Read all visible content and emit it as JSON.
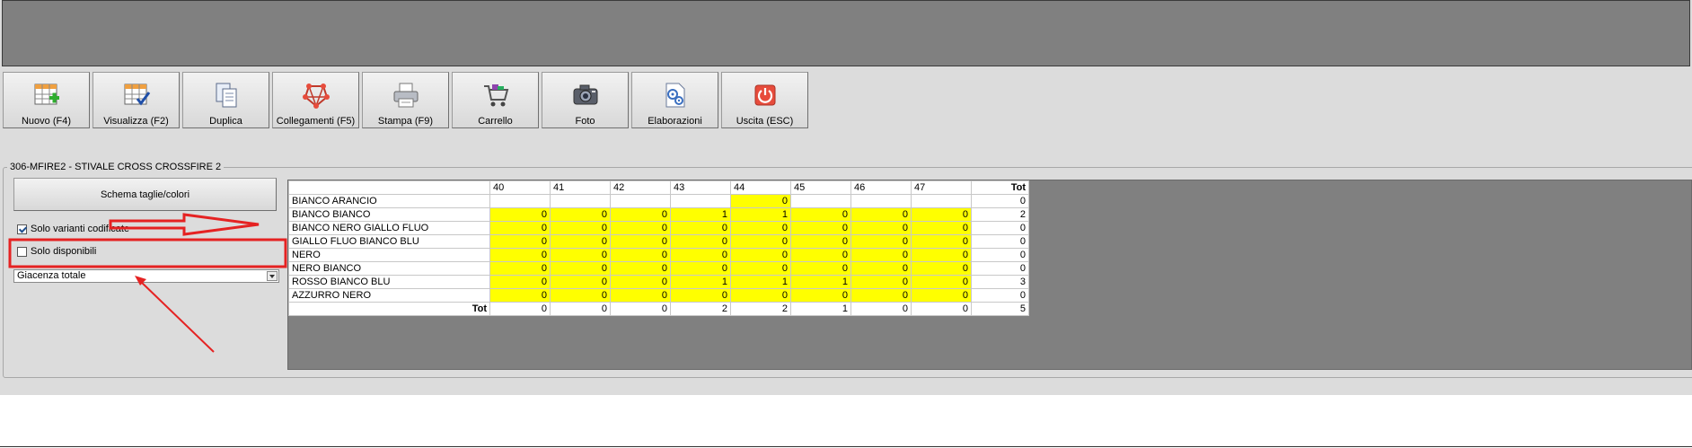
{
  "toolbar": {
    "buttons": [
      {
        "label": "Nuovo (F4)",
        "icon": "new-grid-icon"
      },
      {
        "label": "Visualizza (F2)",
        "icon": "view-grid-icon"
      },
      {
        "label": "Duplica",
        "icon": "duplicate-icon"
      },
      {
        "label": "Collegamenti (F5)",
        "icon": "links-icon"
      },
      {
        "label": "Stampa (F9)",
        "icon": "printer-icon"
      },
      {
        "label": "Carrello",
        "icon": "cart-icon"
      },
      {
        "label": "Foto",
        "icon": "camera-icon"
      },
      {
        "label": "Elaborazioni",
        "icon": "process-icon"
      },
      {
        "label": "Uscita (ESC)",
        "icon": "exit-icon"
      }
    ]
  },
  "group": {
    "title": "306-MFIRE2 - STIVALE CROSS CROSSFIRE 2",
    "schema_button": "Schema taglie/colori",
    "solo_varianti": {
      "label": "Solo varianti codificate",
      "checked": true
    },
    "solo_disponibili": {
      "label": "Solo disponibili",
      "checked": false
    },
    "giacenza_select": {
      "value": "Giacenza totale"
    }
  },
  "grid": {
    "sizes": [
      "40",
      "41",
      "42",
      "43",
      "44",
      "45",
      "46",
      "47"
    ],
    "tot_label": "Tot",
    "rows": [
      {
        "name": "BIANCO ARANCIO",
        "values": [
          "",
          "",
          "",
          "",
          "0",
          "",
          "",
          ""
        ],
        "highlight": [
          false,
          false,
          false,
          false,
          true,
          false,
          false,
          false
        ],
        "tot": "0"
      },
      {
        "name": "BIANCO BIANCO",
        "values": [
          "0",
          "0",
          "0",
          "1",
          "1",
          "0",
          "0",
          "0"
        ],
        "highlight": [
          true,
          true,
          true,
          true,
          true,
          true,
          true,
          true
        ],
        "tot": "2"
      },
      {
        "name": "BIANCO NERO GIALLO FLUO",
        "values": [
          "0",
          "0",
          "0",
          "0",
          "0",
          "0",
          "0",
          "0"
        ],
        "highlight": [
          true,
          true,
          true,
          true,
          true,
          true,
          true,
          true
        ],
        "tot": "0"
      },
      {
        "name": "GIALLO FLUO BIANCO BLU",
        "values": [
          "0",
          "0",
          "0",
          "0",
          "0",
          "0",
          "0",
          "0"
        ],
        "highlight": [
          true,
          true,
          true,
          true,
          true,
          true,
          true,
          true
        ],
        "tot": "0"
      },
      {
        "name": "NERO",
        "values": [
          "0",
          "0",
          "0",
          "0",
          "0",
          "0",
          "0",
          "0"
        ],
        "highlight": [
          true,
          true,
          true,
          true,
          true,
          true,
          true,
          true
        ],
        "tot": "0"
      },
      {
        "name": "NERO BIANCO",
        "values": [
          "0",
          "0",
          "0",
          "0",
          "0",
          "0",
          "0",
          "0"
        ],
        "highlight": [
          true,
          true,
          true,
          true,
          true,
          true,
          true,
          true
        ],
        "tot": "0"
      },
      {
        "name": "ROSSO BIANCO BLU",
        "values": [
          "0",
          "0",
          "0",
          "1",
          "1",
          "1",
          "0",
          "0"
        ],
        "highlight": [
          true,
          true,
          true,
          true,
          true,
          true,
          true,
          true
        ],
        "tot": "3"
      },
      {
        "name": "AZZURRO NERO",
        "values": [
          "0",
          "0",
          "0",
          "0",
          "0",
          "0",
          "0",
          "0"
        ],
        "highlight": [
          true,
          true,
          true,
          true,
          true,
          true,
          true,
          true
        ],
        "tot": "0"
      }
    ],
    "totals": {
      "label": "Tot",
      "values": [
        "0",
        "0",
        "0",
        "2",
        "2",
        "1",
        "0",
        "0"
      ],
      "tot": "5"
    }
  },
  "colors": {
    "highlight": "#ffff00",
    "annotation": "#e52222",
    "grid_bg": "#808080",
    "panel_bg": "#dcdcdc"
  }
}
